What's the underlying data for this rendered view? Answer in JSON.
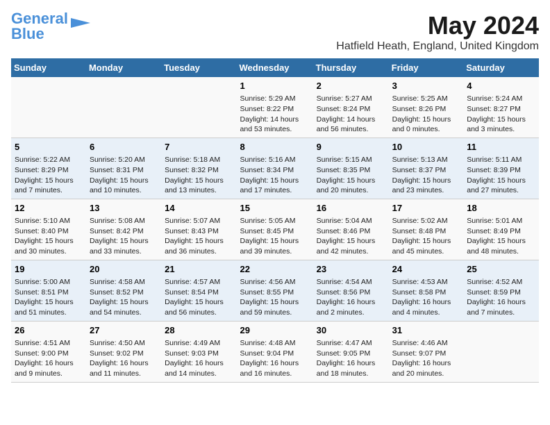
{
  "logo": {
    "text1": "General",
    "text2": "Blue"
  },
  "header": {
    "month": "May 2024",
    "location": "Hatfield Heath, England, United Kingdom"
  },
  "days_of_week": [
    "Sunday",
    "Monday",
    "Tuesday",
    "Wednesday",
    "Thursday",
    "Friday",
    "Saturday"
  ],
  "weeks": [
    {
      "cells": [
        {
          "day": null,
          "content": ""
        },
        {
          "day": null,
          "content": ""
        },
        {
          "day": null,
          "content": ""
        },
        {
          "day": "1",
          "content": "Sunrise: 5:29 AM\nSunset: 8:22 PM\nDaylight: 14 hours and 53 minutes."
        },
        {
          "day": "2",
          "content": "Sunrise: 5:27 AM\nSunset: 8:24 PM\nDaylight: 14 hours and 56 minutes."
        },
        {
          "day": "3",
          "content": "Sunrise: 5:25 AM\nSunset: 8:26 PM\nDaylight: 15 hours and 0 minutes."
        },
        {
          "day": "4",
          "content": "Sunrise: 5:24 AM\nSunset: 8:27 PM\nDaylight: 15 hours and 3 minutes."
        }
      ]
    },
    {
      "cells": [
        {
          "day": "5",
          "content": "Sunrise: 5:22 AM\nSunset: 8:29 PM\nDaylight: 15 hours and 7 minutes."
        },
        {
          "day": "6",
          "content": "Sunrise: 5:20 AM\nSunset: 8:31 PM\nDaylight: 15 hours and 10 minutes."
        },
        {
          "day": "7",
          "content": "Sunrise: 5:18 AM\nSunset: 8:32 PM\nDaylight: 15 hours and 13 minutes."
        },
        {
          "day": "8",
          "content": "Sunrise: 5:16 AM\nSunset: 8:34 PM\nDaylight: 15 hours and 17 minutes."
        },
        {
          "day": "9",
          "content": "Sunrise: 5:15 AM\nSunset: 8:35 PM\nDaylight: 15 hours and 20 minutes."
        },
        {
          "day": "10",
          "content": "Sunrise: 5:13 AM\nSunset: 8:37 PM\nDaylight: 15 hours and 23 minutes."
        },
        {
          "day": "11",
          "content": "Sunrise: 5:11 AM\nSunset: 8:39 PM\nDaylight: 15 hours and 27 minutes."
        }
      ]
    },
    {
      "cells": [
        {
          "day": "12",
          "content": "Sunrise: 5:10 AM\nSunset: 8:40 PM\nDaylight: 15 hours and 30 minutes."
        },
        {
          "day": "13",
          "content": "Sunrise: 5:08 AM\nSunset: 8:42 PM\nDaylight: 15 hours and 33 minutes."
        },
        {
          "day": "14",
          "content": "Sunrise: 5:07 AM\nSunset: 8:43 PM\nDaylight: 15 hours and 36 minutes."
        },
        {
          "day": "15",
          "content": "Sunrise: 5:05 AM\nSunset: 8:45 PM\nDaylight: 15 hours and 39 minutes."
        },
        {
          "day": "16",
          "content": "Sunrise: 5:04 AM\nSunset: 8:46 PM\nDaylight: 15 hours and 42 minutes."
        },
        {
          "day": "17",
          "content": "Sunrise: 5:02 AM\nSunset: 8:48 PM\nDaylight: 15 hours and 45 minutes."
        },
        {
          "day": "18",
          "content": "Sunrise: 5:01 AM\nSunset: 8:49 PM\nDaylight: 15 hours and 48 minutes."
        }
      ]
    },
    {
      "cells": [
        {
          "day": "19",
          "content": "Sunrise: 5:00 AM\nSunset: 8:51 PM\nDaylight: 15 hours and 51 minutes."
        },
        {
          "day": "20",
          "content": "Sunrise: 4:58 AM\nSunset: 8:52 PM\nDaylight: 15 hours and 54 minutes."
        },
        {
          "day": "21",
          "content": "Sunrise: 4:57 AM\nSunset: 8:54 PM\nDaylight: 15 hours and 56 minutes."
        },
        {
          "day": "22",
          "content": "Sunrise: 4:56 AM\nSunset: 8:55 PM\nDaylight: 15 hours and 59 minutes."
        },
        {
          "day": "23",
          "content": "Sunrise: 4:54 AM\nSunset: 8:56 PM\nDaylight: 16 hours and 2 minutes."
        },
        {
          "day": "24",
          "content": "Sunrise: 4:53 AM\nSunset: 8:58 PM\nDaylight: 16 hours and 4 minutes."
        },
        {
          "day": "25",
          "content": "Sunrise: 4:52 AM\nSunset: 8:59 PM\nDaylight: 16 hours and 7 minutes."
        }
      ]
    },
    {
      "cells": [
        {
          "day": "26",
          "content": "Sunrise: 4:51 AM\nSunset: 9:00 PM\nDaylight: 16 hours and 9 minutes."
        },
        {
          "day": "27",
          "content": "Sunrise: 4:50 AM\nSunset: 9:02 PM\nDaylight: 16 hours and 11 minutes."
        },
        {
          "day": "28",
          "content": "Sunrise: 4:49 AM\nSunset: 9:03 PM\nDaylight: 16 hours and 14 minutes."
        },
        {
          "day": "29",
          "content": "Sunrise: 4:48 AM\nSunset: 9:04 PM\nDaylight: 16 hours and 16 minutes."
        },
        {
          "day": "30",
          "content": "Sunrise: 4:47 AM\nSunset: 9:05 PM\nDaylight: 16 hours and 18 minutes."
        },
        {
          "day": "31",
          "content": "Sunrise: 4:46 AM\nSunset: 9:07 PM\nDaylight: 16 hours and 20 minutes."
        },
        {
          "day": null,
          "content": ""
        }
      ]
    }
  ]
}
